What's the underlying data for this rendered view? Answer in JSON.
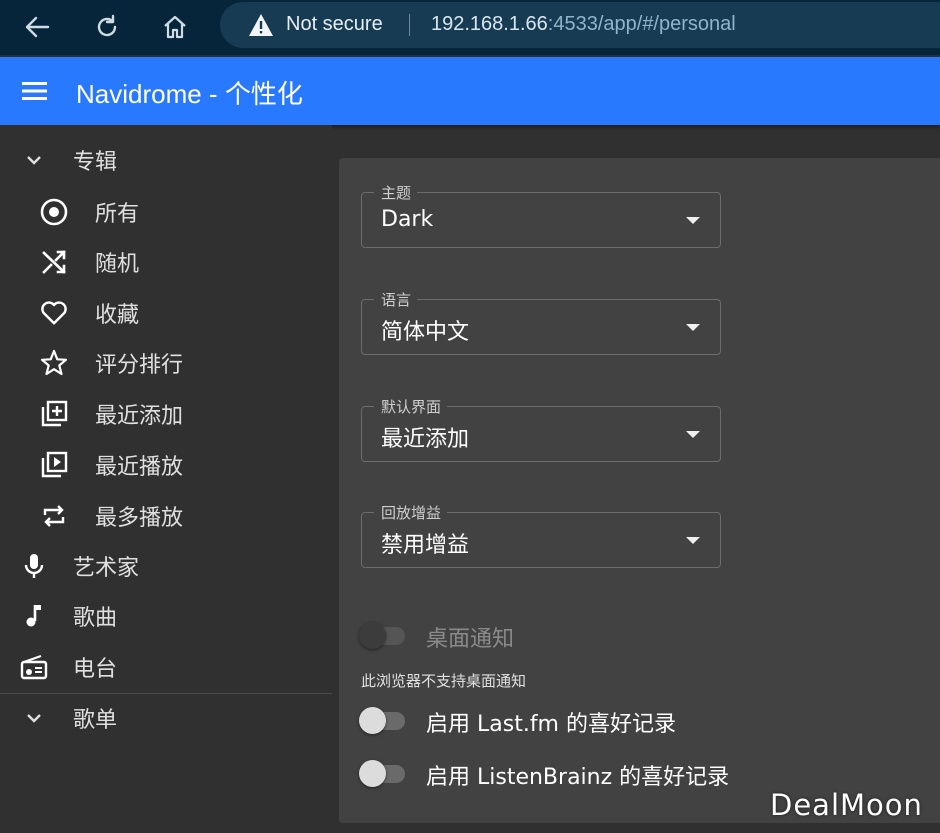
{
  "browser": {
    "security_label": "Not secure",
    "url_host": "192.168.1.66",
    "url_rest": ":4533/app/#/personal"
  },
  "appbar": {
    "title": "Navidrome - 个性化"
  },
  "sidebar": {
    "albums": "专辑",
    "album_items": [
      {
        "label": "所有",
        "icon": "album-disc-icon"
      },
      {
        "label": "随机",
        "icon": "shuffle-icon"
      },
      {
        "label": "收藏",
        "icon": "heart-icon"
      },
      {
        "label": "评分排行",
        "icon": "star-icon"
      },
      {
        "label": "最近添加",
        "icon": "library-add-icon"
      },
      {
        "label": "最近播放",
        "icon": "video-library-icon"
      },
      {
        "label": "最多播放",
        "icon": "repeat-icon"
      }
    ],
    "artists": "艺术家",
    "songs": "歌曲",
    "radio": "电台",
    "playlists": "歌单"
  },
  "settings": {
    "theme": {
      "label": "主题",
      "value": "Dark"
    },
    "language": {
      "label": "语言",
      "value": "简体中文"
    },
    "default_view": {
      "label": "默认界面",
      "value": "最近添加"
    },
    "replay_gain": {
      "label": "回放增益",
      "value": "禁用增益"
    },
    "desktop_notif": {
      "label": "桌面通知",
      "enabled": false,
      "disabled": true
    },
    "notif_helper": "此浏览器不支持桌面通知",
    "lastfm": {
      "label": "启用 Last.fm 的喜好记录",
      "enabled": false
    },
    "listenbrainz": {
      "label": "启用 ListenBrainz 的喜好记录",
      "enabled": false
    }
  },
  "watermark": "DealMoon",
  "colors": {
    "accent": "#2979ff",
    "background": "#303030",
    "card": "#424242"
  }
}
